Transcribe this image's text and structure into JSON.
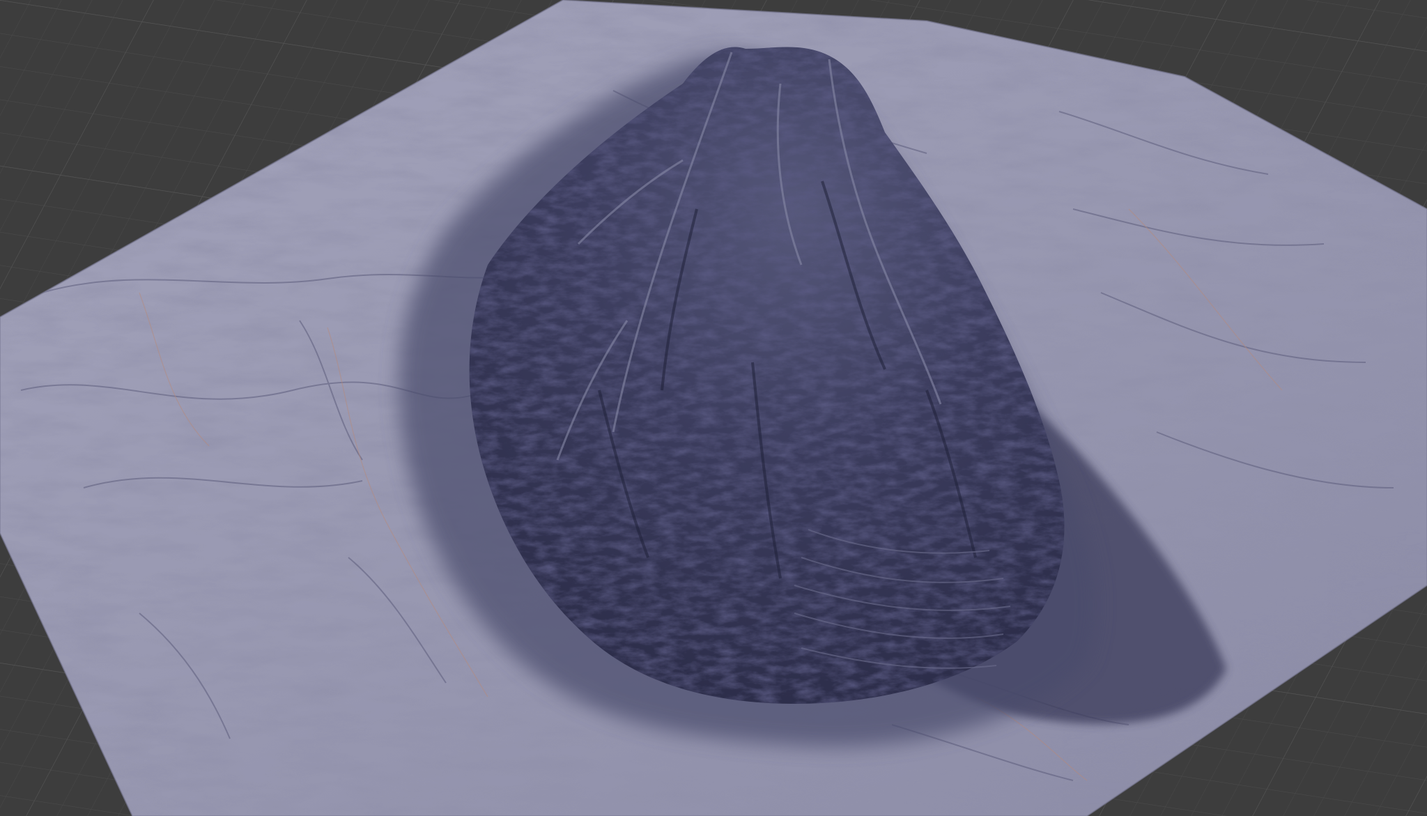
{
  "viewport": {
    "background_color": "#3d3d3d",
    "grid_line_color": "#4a4a4a",
    "grid_major_color": "#555555"
  },
  "terrain": {
    "plane_color": "#9b9bb3",
    "plane_shadow_color": "#6f6f8c",
    "rock_dark_color": "#2a2b45",
    "rock_mid_color": "#4a4b6c",
    "rock_light_color": "#8789a6",
    "strata_highlight_color": "#b8897a",
    "cast_shadow_color": "#3a3b5a"
  }
}
